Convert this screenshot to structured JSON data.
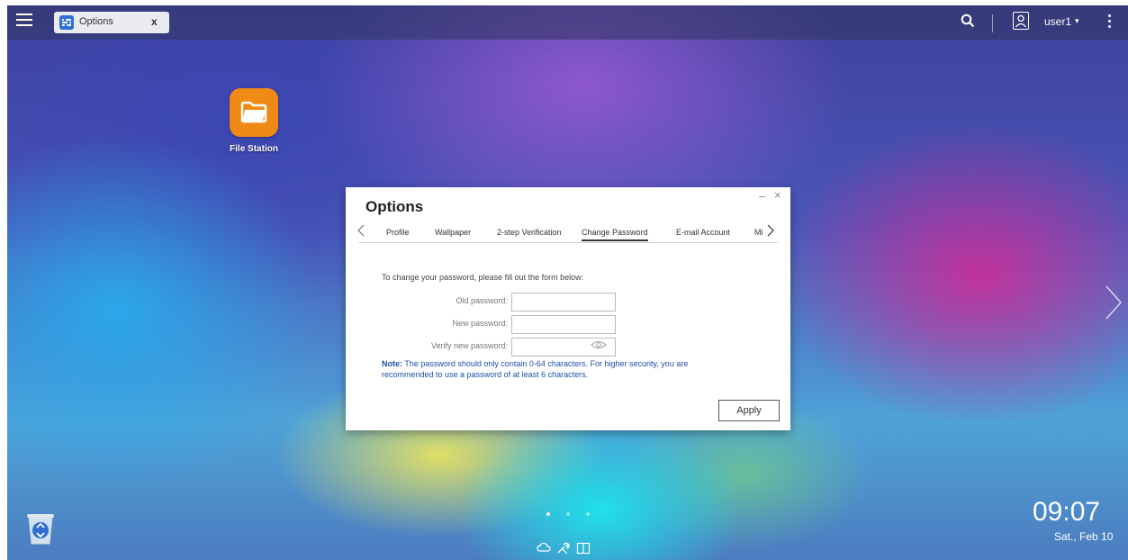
{
  "topbar": {
    "task_tab_label": "Options",
    "task_tab_close": "x",
    "user_name": "user1",
    "user_caret": "▾"
  },
  "desktop": {
    "apps": [
      {
        "label": "File Station",
        "icon": "folder-icon"
      }
    ]
  },
  "dialog": {
    "title": "Options",
    "minimize": "–",
    "close": "×",
    "tabs": [
      "Profile",
      "Wallpaper",
      "2-step Verification",
      "Change Password",
      "E-mail Account",
      "Mi"
    ],
    "active_tab": "Change Password",
    "form": {
      "intro": "To change your password, please fill out the form below:",
      "old_password_label": "Old password:",
      "new_password_label": "New password:",
      "verify_password_label": "Verify new password:",
      "old_password_value": "",
      "new_password_value": "",
      "verify_password_value": ""
    },
    "note_prefix": "Note:",
    "note_text": " The password should only contain 0-64 characters. For higher security, you are recommended to use a password of at least 6 characters.",
    "apply_label": "Apply"
  },
  "bottom": {
    "page_count": 3,
    "current_page": 1,
    "dock_icons": [
      "cloud-icon",
      "tools-icon",
      "book-icon"
    ]
  },
  "clock": {
    "time": "09:07",
    "date": "Sat., Feb 10"
  },
  "colors": {
    "accent_blue": "#2f6fd6",
    "note_blue": "#1e4fa8",
    "app_orange": "#f08a16"
  }
}
